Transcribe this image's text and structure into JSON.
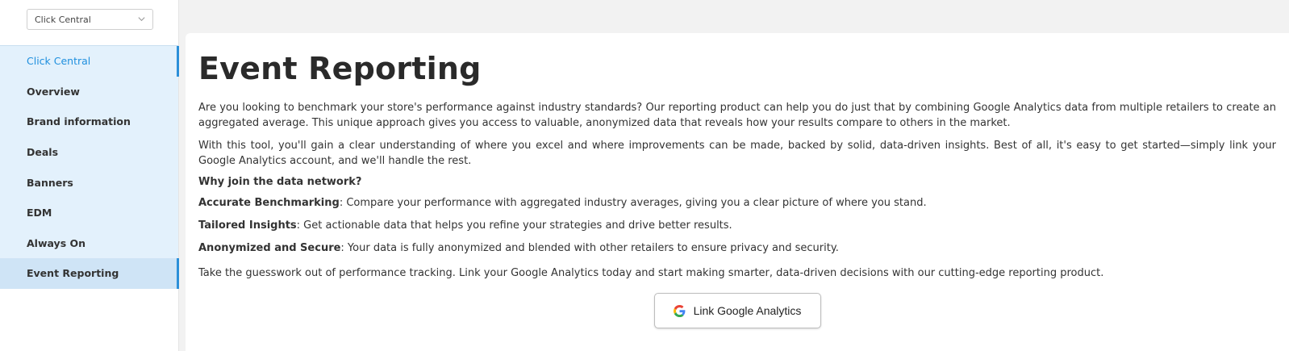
{
  "store_selector": {
    "value": "Click Central"
  },
  "sidebar": {
    "items": [
      {
        "label": "Click Central"
      },
      {
        "label": "Overview"
      },
      {
        "label": "Brand information"
      },
      {
        "label": "Deals"
      },
      {
        "label": "Banners"
      },
      {
        "label": "EDM"
      },
      {
        "label": "Always On"
      },
      {
        "label": "Event Reporting"
      }
    ]
  },
  "main": {
    "title": "Event Reporting",
    "intro": "Are you looking to benchmark your store's performance against industry standards? Our reporting product can help you do just that by combining Google Analytics data from multiple retailers to create an aggregated average. This unique approach gives you access to valuable, anonymized data that reveals how your results compare to others in the market.",
    "tool_paragraph": "With this tool, you'll gain a clear understanding of where you excel and where improvements can be made, backed by solid, data-driven insights. Best of all, it's easy to get started—simply link your Google Analytics account, and we'll handle the rest.",
    "why_heading": "Why join the data network?",
    "benefits": [
      {
        "title": "Accurate Benchmarking",
        "text": ": Compare your performance with aggregated industry averages, giving you a clear picture of where you stand."
      },
      {
        "title": "Tailored Insights",
        "text": ": Get actionable data that helps you refine your strategies and drive better results."
      },
      {
        "title": "Anonymized and Secure",
        "text": ": Your data is fully anonymized and blended with other retailers to ensure privacy and security."
      }
    ],
    "closing": "Take the guesswork out of performance tracking. Link your Google Analytics today and start making smarter, data-driven decisions with our cutting-edge reporting product.",
    "cta_label": "Link Google Analytics"
  },
  "colors": {
    "accent": "#2b8fd9",
    "sidebar_bg": "#e3f1fc",
    "active_bg": "#cfe4f6"
  },
  "icons": {
    "select": "chevron-down-icon",
    "cta": "google-g-icon"
  }
}
